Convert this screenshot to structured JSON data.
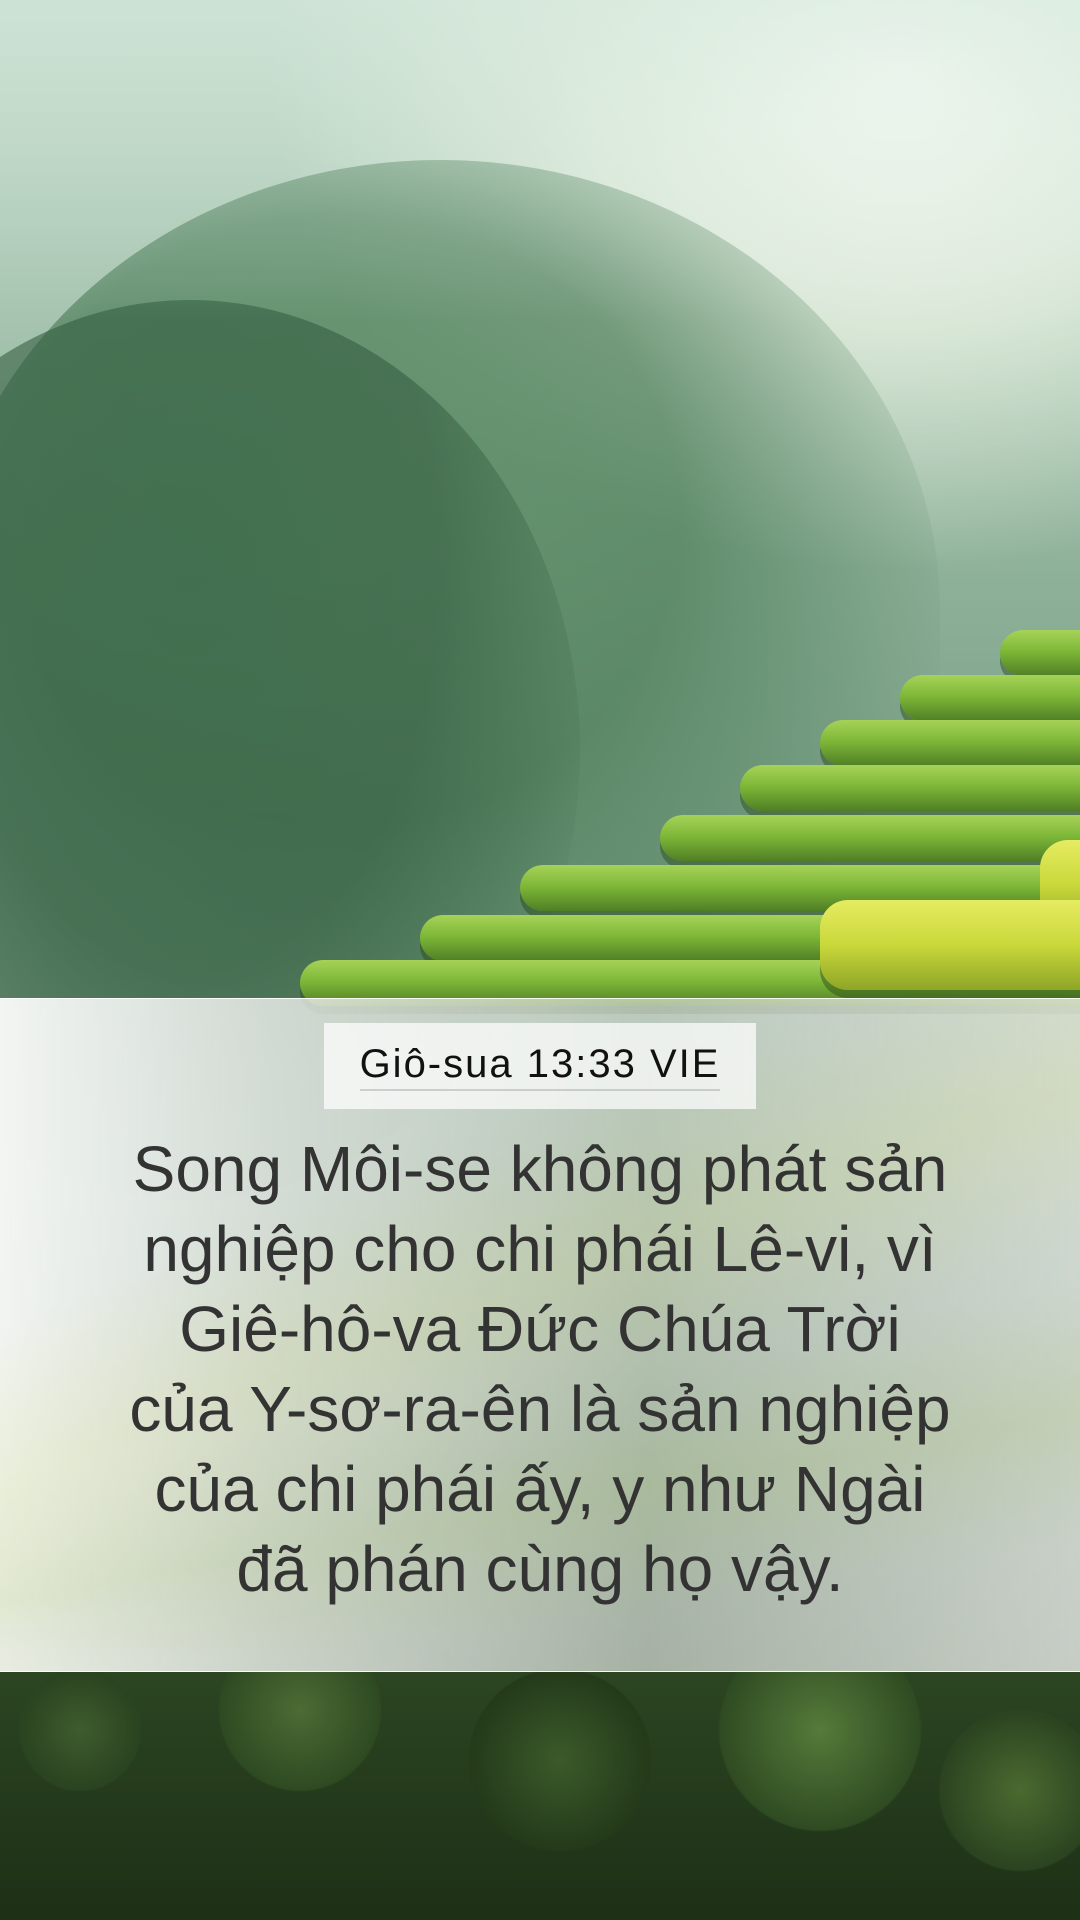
{
  "verse": {
    "reference": "Giô-sua 13:33 VIE",
    "lines": [
      "Song Môi-se không phát sản",
      "nghiệp cho chi phái Lê-vi, vì",
      "Giê-hô-va Đức Chúa Trời",
      "của Y-sơ-ra-ên là sản nghiệp",
      "của chi phái ấy, y như Ngài",
      "đã phán cùng họ vậy."
    ]
  },
  "background": {
    "subject": "terraced rice fields with misty forested hills",
    "colors": {
      "mist": "#c7dccd",
      "terrace_green": "#7fb838",
      "terrace_yellow": "#c9d83a",
      "forest": "#24381f"
    }
  }
}
